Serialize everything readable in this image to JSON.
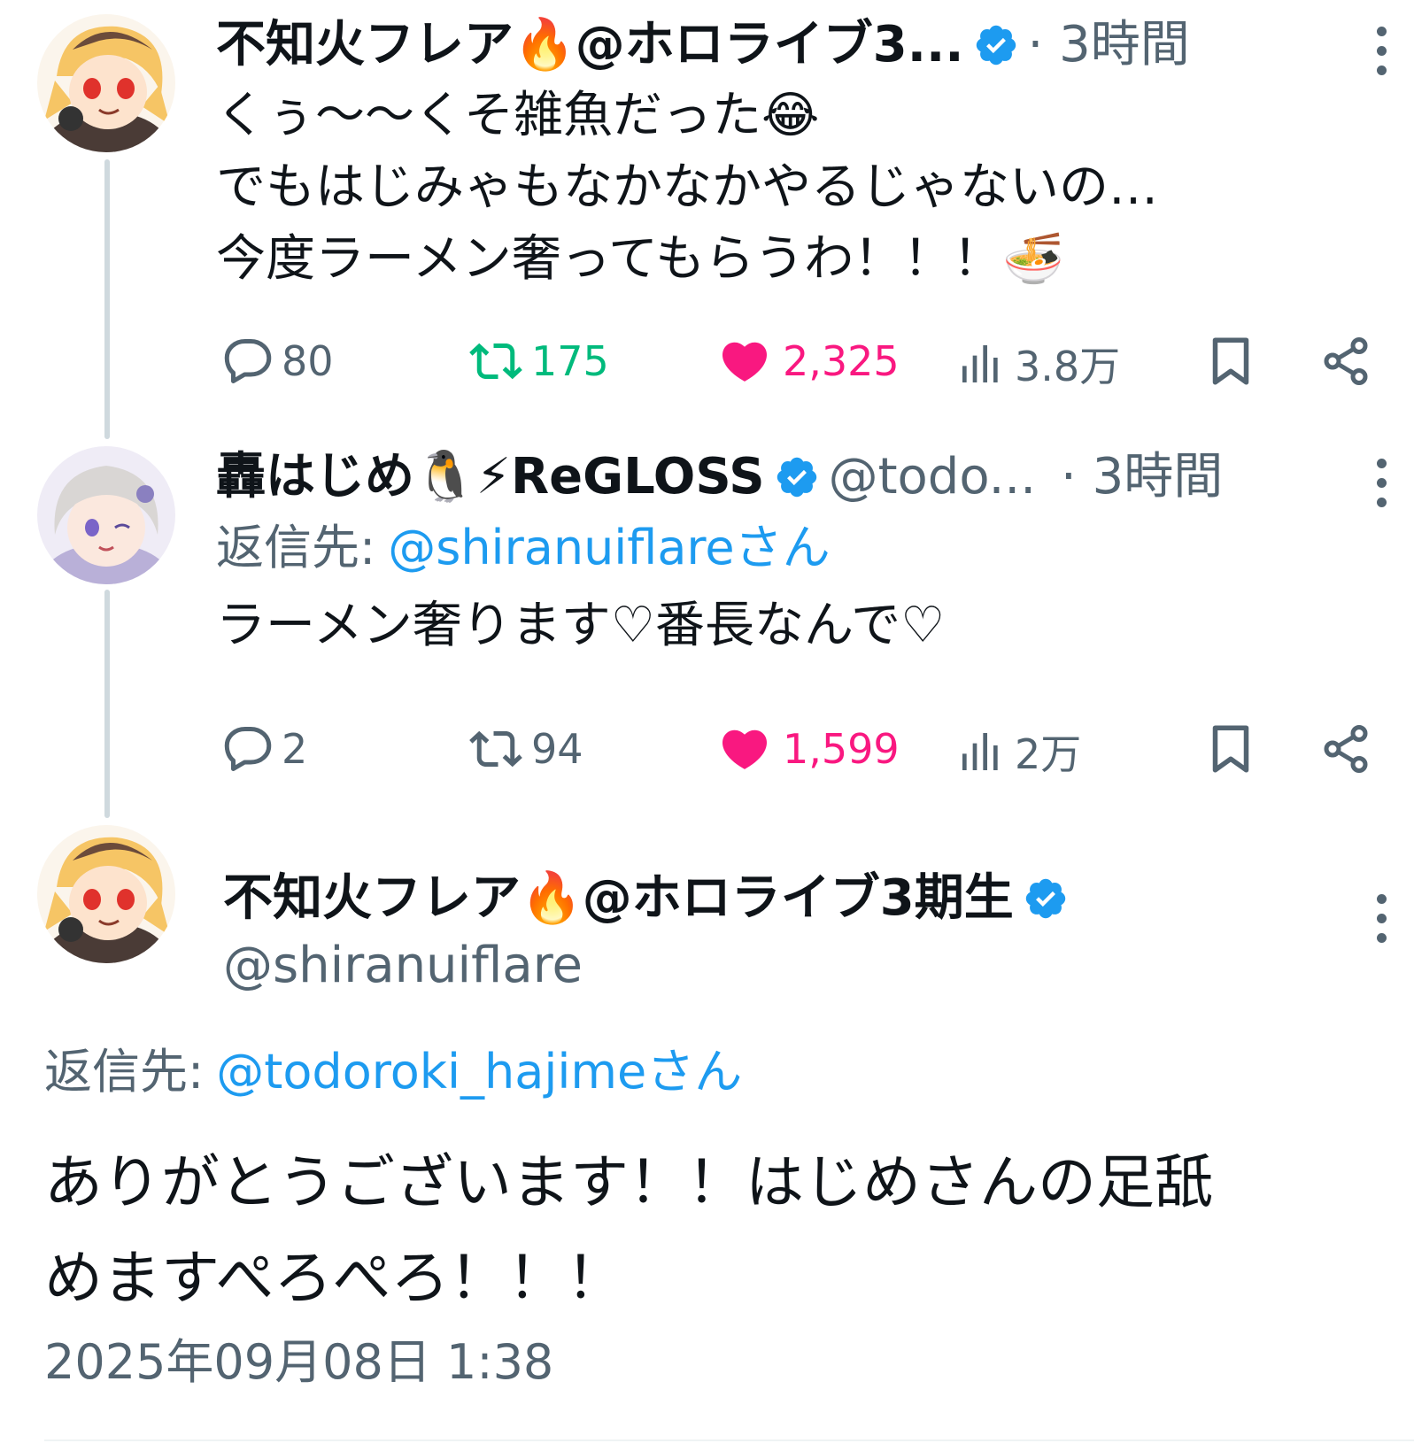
{
  "colors": {
    "verified": "#1d9bf0",
    "like": "#f91880",
    "retweet": "#00ba7c",
    "gray": "#536471"
  },
  "tweet1": {
    "name": "不知火フレア🔥@ホロライブ3...",
    "time": "· 3時間",
    "lines": [
      "くぅ〜〜くそ雑魚だった😂",
      "でもはじみゃもなかなかやるじゃないの…",
      "今度ラーメン奢ってもらうわ！！！🍜"
    ],
    "replies": "80",
    "retweets": "175",
    "likes": "2,325",
    "views": "3.8万",
    "retweeted": true,
    "liked": true
  },
  "tweet2": {
    "name": "轟はじめ🐧⚡ReGLOSS",
    "handle": "@todo...",
    "time": "· 3時間",
    "reply_prefix": "返信先:",
    "reply_to": "@shiranuiflareさん",
    "text": "ラーメン奢ります♡番長なんで♡",
    "replies": "2",
    "retweets": "94",
    "likes": "1,599",
    "views": "2万",
    "liked": true
  },
  "tweet3": {
    "name": "不知火フレア🔥@ホロライブ3期生",
    "handle": "@shiranuiflare",
    "reply_prefix": "返信先:",
    "reply_to": "@todoroki_hajimeさん",
    "lines": [
      "ありがとうございます！！はじめさんの足舐",
      "めますぺろぺろ！！！"
    ],
    "timestamp": "2025年09月08日 1:38"
  },
  "icons": [
    "verified-badge-icon",
    "more-icon",
    "reply-icon",
    "retweet-icon",
    "like-icon",
    "views-icon",
    "bookmark-icon",
    "share-icon"
  ]
}
